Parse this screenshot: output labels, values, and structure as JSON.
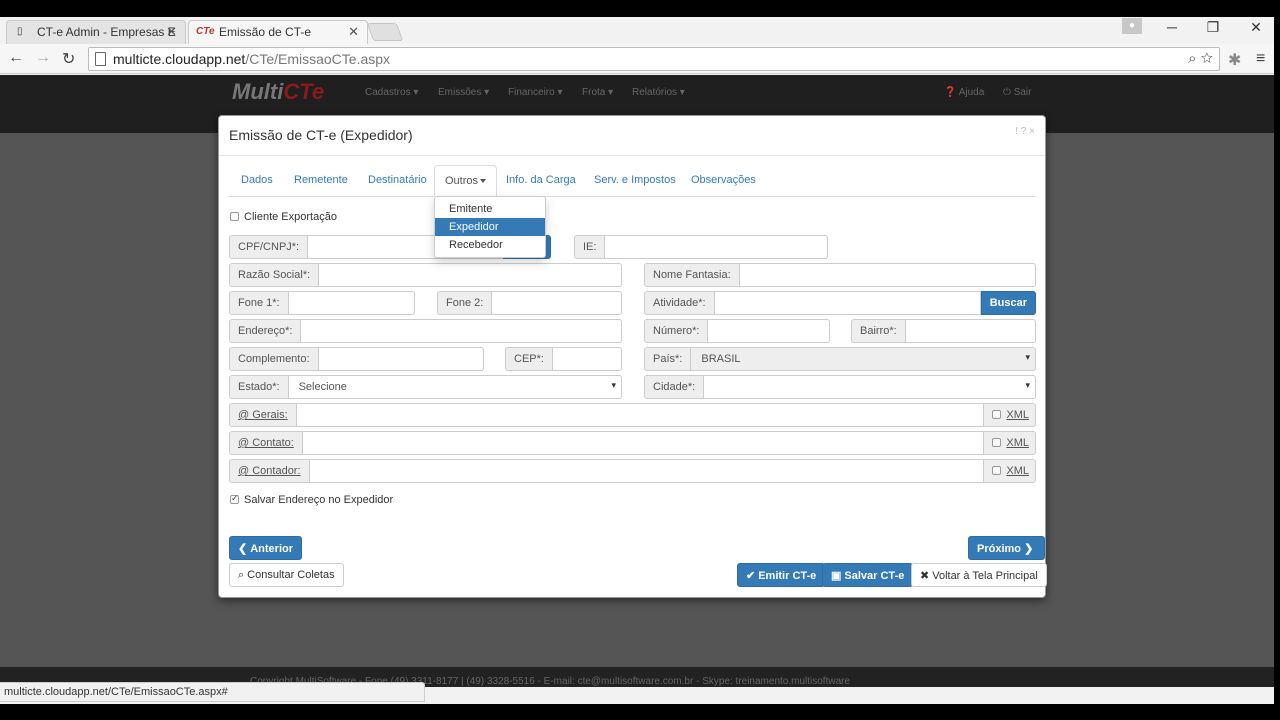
{
  "browser": {
    "tabs": [
      {
        "title": "CT-e Admin - Empresas E",
        "active": false
      },
      {
        "title": "Emissão de CT-e",
        "active": true,
        "favicon_text": "CTe"
      }
    ],
    "url_host": "multicte.cloudapp.net",
    "url_path": "/CTe/EmissaoCTe.aspx",
    "status_url": "multicte.cloudapp.net/CTe/EmissaoCTe.aspx#"
  },
  "app": {
    "logo_text": "Multi",
    "logo_accent": "CTe",
    "menu": [
      "Cadastros",
      "Emissões",
      "Financeiro",
      "Frota",
      "Relatórios"
    ],
    "help": "Ajuda",
    "logout": "Sair",
    "footer": "Copyright MultiSoftware - Fone (49) 3311-8177 | (49) 3328-5516 - E-mail: cte@multisoftware.com.br - Skype: treinamento.multisoftware"
  },
  "modal": {
    "title": "Emissão de CT-e (Expedidor)",
    "header_controls": "! ? ×",
    "tabs": [
      "Dados",
      "Remetente",
      "Destinatário",
      "Outros",
      "Info. da Carga",
      "Serv. e Impostos",
      "Observações"
    ],
    "dropdown": [
      {
        "label": "Emitente",
        "active": false
      },
      {
        "label": "Expedidor",
        "active": true
      },
      {
        "label": "Recebedor",
        "active": false
      }
    ],
    "cliente_exportacao": "Cliente Exportação",
    "fields": {
      "cpf_cnpj": "CPF/CNPJ*:",
      "ie": "IE:",
      "razao_social": "Razão Social*:",
      "nome_fantasia": "Nome Fantasia:",
      "fone1": "Fone 1*:",
      "fone2": "Fone 2:",
      "atividade": "Atividade*:",
      "buscar": "Buscar",
      "endereco": "Endereço*:",
      "numero": "Número*:",
      "bairro": "Bairro*:",
      "complemento": "Complemento:",
      "cep": "CEP*:",
      "pais": "País*:",
      "pais_value": "BRASIL",
      "estado": "Estado*:",
      "estado_value": "Selecione",
      "cidade": "Cidade*:",
      "email_gerais": "@ Gerais:",
      "email_contato": "@ Contato:",
      "email_contador": "@ Contador:",
      "xml": "XML"
    },
    "salvar_endereco": "Salvar Endereço no Expedidor",
    "buttons": {
      "anterior": "Anterior",
      "proximo": "Próximo",
      "consultar_coletas": "Consultar Coletas",
      "emitir": "Emitir CT-e",
      "salvar": "Salvar CT-e",
      "voltar": "Voltar à Tela Principal"
    }
  }
}
